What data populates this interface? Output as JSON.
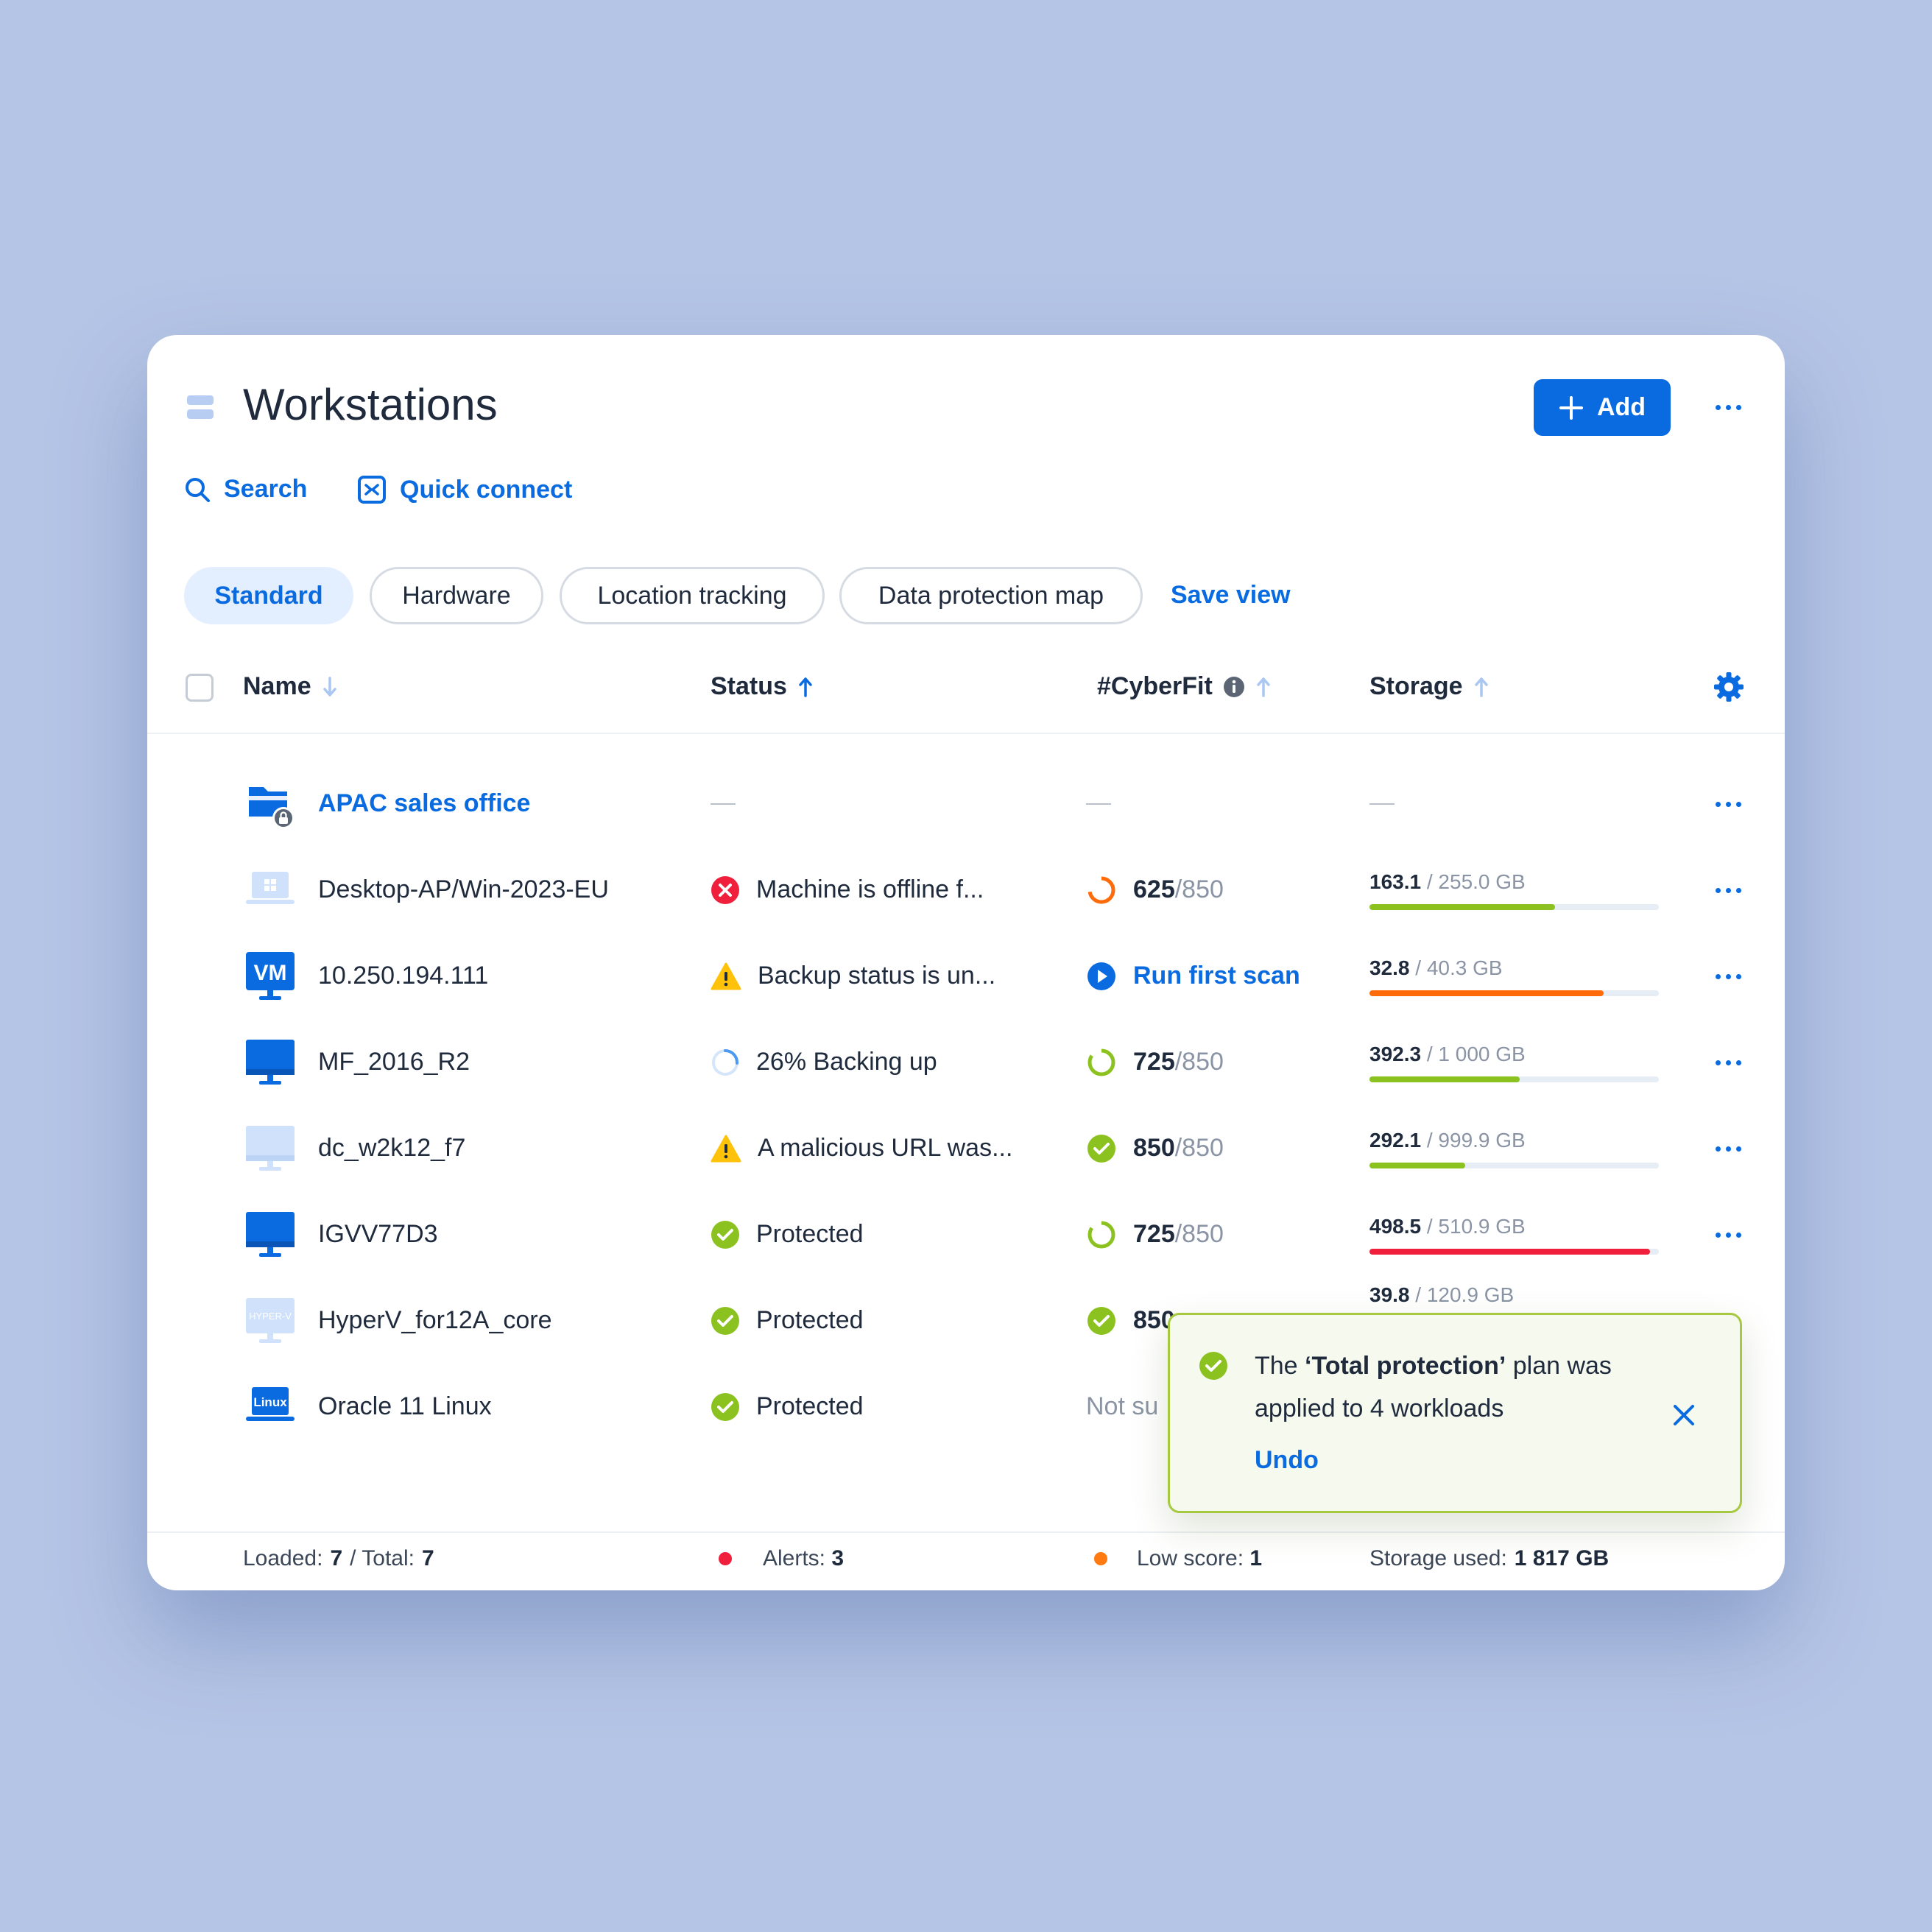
{
  "header": {
    "title": "Workstations",
    "add_label": "Add"
  },
  "toolbar": {
    "search_label": "Search",
    "quick_connect_label": "Quick connect"
  },
  "views": {
    "tabs": [
      "Standard",
      "Hardware",
      "Location tracking",
      "Data protection map"
    ],
    "active": "Standard",
    "save_view_label": "Save view"
  },
  "columns": {
    "name": "Name",
    "status": "Status",
    "cyberfit": "#CyberFit",
    "storage": "Storage"
  },
  "group": {
    "name": "APAC sales office",
    "status": "—",
    "cyberfit": "—",
    "storage": "—"
  },
  "rows": [
    {
      "name": "Desktop-AP/Win-2023-EU",
      "device_icon": "windows-laptop-icon",
      "status": "Machine is offline f...",
      "status_icon": "error-icon",
      "score": "625",
      "score_max": "/850",
      "score_icon": "score-ring-orange-icon",
      "storage_used": "163.1",
      "storage_total": "/ 255.0 GB",
      "storage_fraction": 0.64,
      "bar_color": "#8cc21f"
    },
    {
      "name": "10.250.194.111",
      "device_icon": "vm-icon",
      "status": "Backup status is un...",
      "status_icon": "warning-icon",
      "score_action": "Run first scan",
      "score_icon": "play-icon",
      "storage_used": "32.8",
      "storage_total": "/ 40.3 GB",
      "storage_fraction": 0.81,
      "bar_color": "#ff6b0a"
    },
    {
      "name": "MF_2016_R2",
      "device_icon": "monitor-icon",
      "status": "26% Backing up",
      "status_icon": "progress-ring-icon",
      "score": "725",
      "score_max": "/850",
      "score_icon": "score-ring-green-icon",
      "storage_used": "392.3",
      "storage_total": "/ 1 000 GB",
      "storage_fraction": 0.52,
      "bar_color": "#8cc21f"
    },
    {
      "name": "dc_w2k12_f7",
      "device_icon": "monitor-light-icon",
      "status": "A malicious URL was...",
      "status_icon": "warning-icon",
      "score": "850",
      "score_max": "/850",
      "score_icon": "check-circle-icon",
      "storage_used": "292.1",
      "storage_total": "/ 999.9 GB",
      "storage_fraction": 0.33,
      "bar_color": "#8cc21f"
    },
    {
      "name": "IGVV77D3",
      "device_icon": "monitor-icon",
      "status": "Protected",
      "status_icon": "check-circle-icon",
      "score": "725",
      "score_max": "/850",
      "score_icon": "score-ring-green-icon",
      "storage_used": "498.5",
      "storage_total": "/ 510.9 GB",
      "storage_fraction": 0.97,
      "bar_color": "#f0203c"
    },
    {
      "name": "HyperV_for12A_core",
      "device_icon": "hyperv-icon",
      "status": "Protected",
      "status_icon": "check-circle-icon",
      "score": "850",
      "score_icon": "check-circle-icon",
      "storage_used": "39.8",
      "storage_total": "/ 120.9 GB"
    },
    {
      "name": "Oracle 11 Linux",
      "device_icon": "linux-laptop-icon",
      "status": "Protected",
      "status_icon": "check-circle-icon",
      "score_note": "Not su"
    }
  ],
  "footer": {
    "loaded_label": "Loaded:",
    "loaded": "7",
    "total_label": "/ Total:",
    "total": "7",
    "alerts_label": "Alerts:",
    "alerts": "3",
    "low_score_label": "Low score:",
    "low_score": "1",
    "storage_label": "Storage used:",
    "storage": "1 817 GB"
  },
  "toast": {
    "prefix": "The ",
    "plan": "‘Total protection’",
    "suffix": " plan was applied to 4 workloads",
    "undo": "Undo"
  },
  "colors": {
    "accent": "#0a6be0",
    "success": "#8cc21f",
    "warning": "#ffc20a",
    "error": "#f0203c",
    "orange": "#ff6b0a"
  }
}
